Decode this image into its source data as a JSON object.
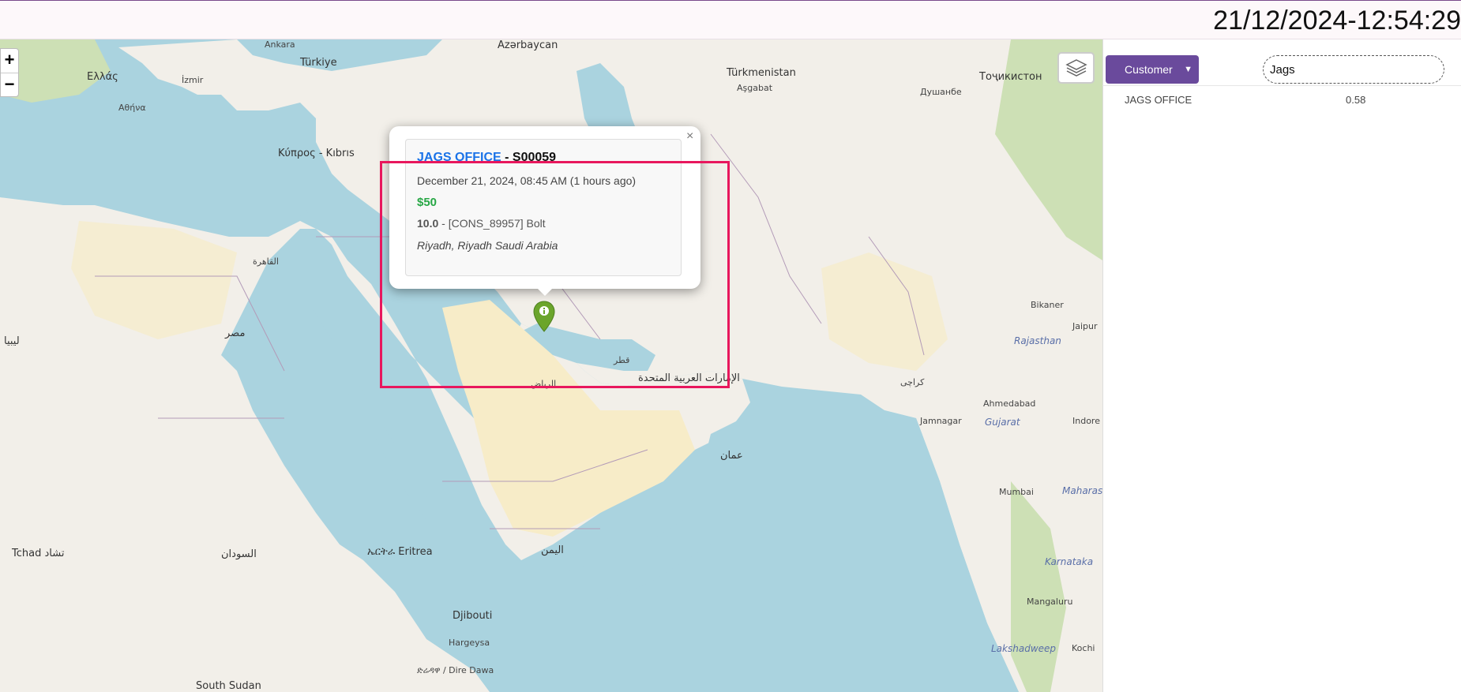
{
  "header": {
    "clock": "21/12/2024-12:54:29"
  },
  "map": {
    "zoom_in": "+",
    "zoom_out": "−",
    "labels": {
      "greece": "Ελλάς",
      "turkiye": "Türkiye",
      "cyprus": "Κύπρος - Kıbrıs",
      "azerbaycan": "Azərbaycan",
      "turkmenistan": "Türkmenistan",
      "ashgabat": "Aşgabat",
      "dushanbe": "Душанбе",
      "tojikiston": "Тоҷикистон",
      "ankara": "Ankara",
      "izmir": "İzmir",
      "athens": "Αθήνα",
      "libya": "ليبيا",
      "egypt": "مصر",
      "cairo": "القاهرة",
      "riyadh": "الرياض",
      "qatar": "قطر",
      "uae": "الإمارات العربية المتحدة",
      "oman": "عمان",
      "yemen": "اليمن",
      "sudan": "السودان",
      "djibouti": "Djibouti",
      "eritrea": "ኤርትራ Eritrea",
      "jamnagar": "Jamnagar",
      "ahmedabad": "Ahmedabad",
      "mumbai": "Mumbai",
      "karachi": "كراچى",
      "bikaner": "Bikaner",
      "jaipur": "Jaipur",
      "indore": "Indore",
      "mangaluru": "Mangaluru",
      "kochi": "Kochi",
      "south_sudan": "South Sudan",
      "hargeysa": "Hargeysa",
      "tchad": "Tchad تشاد",
      "dire_dawa": "ድሬዳዋ / Dire Dawa",
      "lakshadweep": "Lakshadweep",
      "gujarat": "Gujarat",
      "rajasthan": "Rajasthan",
      "maharashtra": "Maharashtra",
      "karnataka": "Karnataka"
    }
  },
  "popup": {
    "close": "×",
    "name": "JAGS OFFICE",
    "separator": " - ",
    "code": "S00059",
    "date": "December 21, 2024, 08:45 AM (1 hours ago)",
    "price": "$50",
    "qty": "10.0",
    "item": " - [CONS_89957] Bolt",
    "address": "Riyadh, Riyadh Saudi Arabia"
  },
  "panel": {
    "select_value": "Customer",
    "search_value": "Jags",
    "results": [
      {
        "name": "JAGS OFFICE",
        "value": "0.58"
      }
    ]
  },
  "colors": {
    "highlight": "#e8175d",
    "select_bg": "#6a4a9c",
    "link": "#1a73e8",
    "price": "#27a745",
    "marker": "#6ba52b"
  }
}
